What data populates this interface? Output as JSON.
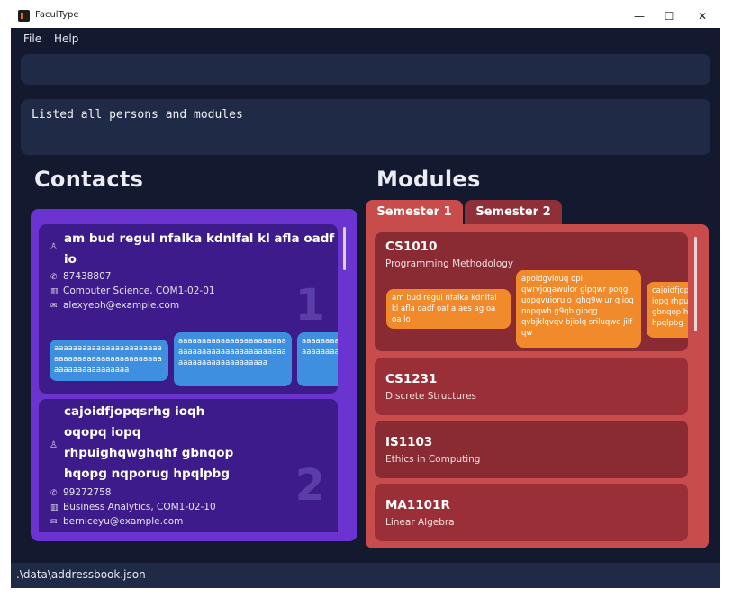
{
  "window": {
    "title": "FaculType",
    "minimize": "—",
    "maximize": "☐",
    "close": "✕"
  },
  "menu": {
    "file": "File",
    "help": "Help"
  },
  "command_box": {
    "value": ""
  },
  "result": {
    "text": "Listed all persons and modules"
  },
  "contacts": {
    "heading": "Contacts",
    "persons": [
      {
        "name_lines": [
          "am bud regul nfalka kdnlfal kl afla oadf oa",
          "io"
        ],
        "phone": "87438807",
        "department": "Computer Science, COM1-02-01",
        "email": "alexyeoh@example.com",
        "index": "1",
        "tags": [
          "aaaaaaaaaaaaaaaaaaaaaaaaaaaaaaaaaaaaaaaaaaaaaaaaaaaaaaaaaaaaaa",
          "aaaaaaaaaaaaaaaaaaaaaaaaaaaaaaaaaaaaaaaaaaaaaaaaaaaaaaaaaaaaaaaaa",
          "aaaaaaaaaaaaaaaaaaaaaa"
        ]
      },
      {
        "name_lines": [
          "cajoidfjopqsrhg ioqh",
          "oqopq iopq",
          "rhpuighqwghqhf gbnqop",
          "hqopg nqporug hpqlpbg"
        ],
        "phone": "99272758",
        "department": "Business Analytics, COM1-02-10",
        "email": "berniceyu@example.com",
        "index": "2"
      }
    ]
  },
  "modules": {
    "heading": "Modules",
    "tabs": [
      "Semester 1",
      "Semester 2"
    ],
    "items": [
      {
        "code": "CS1010",
        "name": "Programming Methodology",
        "tags": [
          "am bud regul nfalka kdnlfal kl afla oadf oaf a aes ag oa oa lo",
          "apoidgviouq opi qwrvjoqawulor gipqwr poqg uopqvuioruio lghq9w ur q iog nopqwh g9qb gipqg qvbjklqvqv bjiolq sriluqwe jilf qw",
          "cajoidfjop iopq rhpu gbnqop hq hpqlpbg"
        ]
      },
      {
        "code": "CS1231",
        "name": "Discrete Structures"
      },
      {
        "code": "IS1103",
        "name": "Ethics in Computing"
      },
      {
        "code": "MA1101R",
        "name": "Linear Algebra"
      }
    ]
  },
  "status_bar": {
    "path": ".\\data\\addressbook.json"
  },
  "colors": {
    "background": "#131a30",
    "contacts_panel": "#6b34d1",
    "person_card": "#3d1b8a",
    "modules_panel": "#c94c4c",
    "module_card": "#9a2f38",
    "tag_blue": "#3f8fe0",
    "tag_orange": "#f08a2a"
  },
  "icons": {
    "person": "person-icon",
    "phone": "phone-icon",
    "department": "building-icon",
    "email": "mail-icon"
  }
}
